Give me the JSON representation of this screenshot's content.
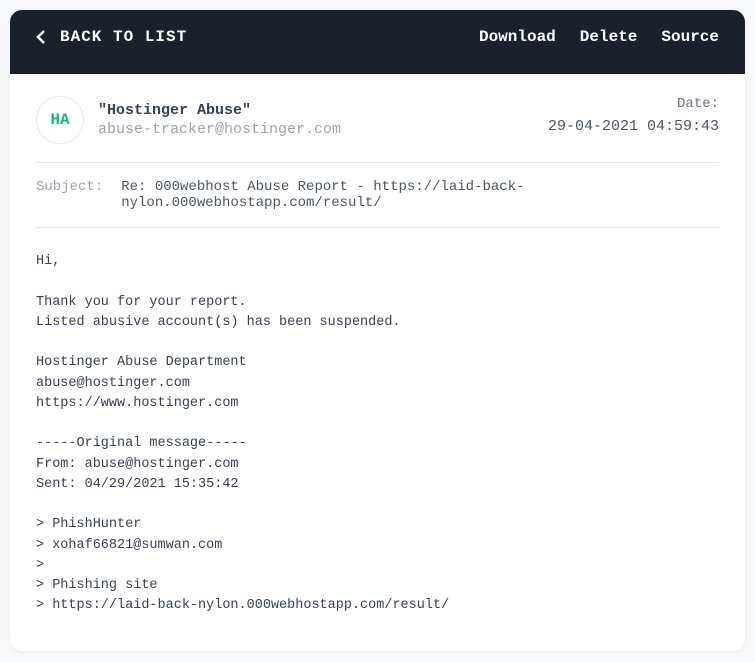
{
  "header": {
    "back_label": "BACK TO LIST",
    "actions": {
      "download": "Download",
      "delete": "Delete",
      "source": "Source"
    }
  },
  "from": {
    "initials": "HA",
    "name": "\"Hostinger Abuse\"",
    "email": "abuse-tracker@hostinger.com"
  },
  "date": {
    "label": "Date:",
    "value": "29-04-2021 04:59:43"
  },
  "subject": {
    "label": "Subject:",
    "value": "Re: 000webhost Abuse Report - https://laid-back-nylon.000webhostapp.com/result/"
  },
  "body": "Hi,\n\nThank you for your report.\nListed abusive account(s) has been suspended.\n\nHostinger Abuse Department\nabuse@hostinger.com\nhttps://www.hostinger.com\n\n-----Original message-----\nFrom: abuse@hostinger.com\nSent: 04/29/2021 15:35:42\n\n> PhishHunter\n> xohaf66821@sumwan.com\n>\n> Phishing site\n> https://laid-back-nylon.000webhostapp.com/result/"
}
